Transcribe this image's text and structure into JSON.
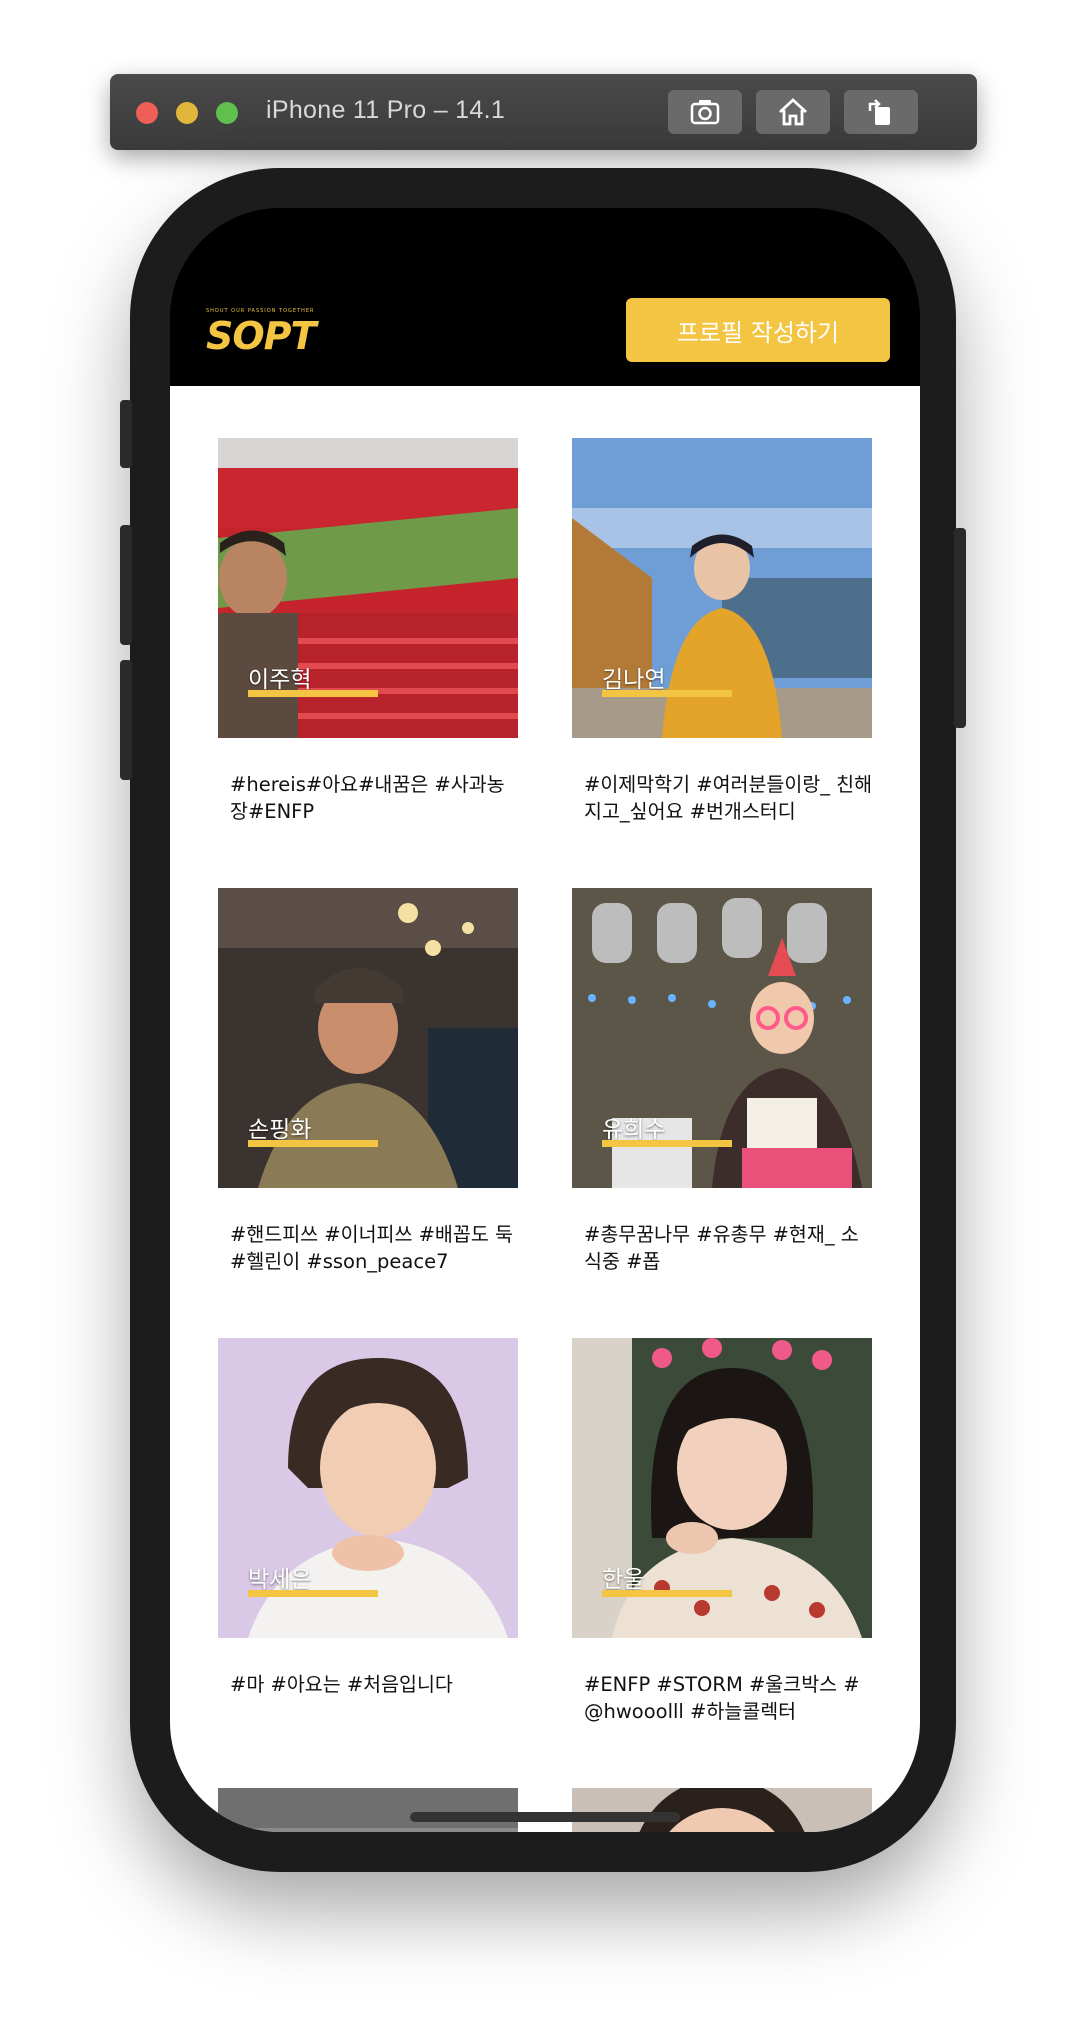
{
  "simulator": {
    "title": "iPhone 11 Pro – 14.1",
    "buttons": [
      "screenshot-icon",
      "home-icon",
      "rotate-icon"
    ]
  },
  "header": {
    "logo_tagline": "SHOUT OUR PASSION TOGETHER",
    "logo_text": "SOPT",
    "profile_button": "프로필 작성하기"
  },
  "colors": {
    "accent": "#f4c542",
    "header_bg": "#000000"
  },
  "cards": [
    {
      "name": "이주혁",
      "tags": "#hereis#아요#내꿈은 #사과농장#ENFP",
      "photo": "stadium"
    },
    {
      "name": "김나연",
      "tags": "#이제막학기 #여러분들이랑_ 친해지고_싶어요 #번개스터디",
      "photo": "river"
    },
    {
      "name": "손핑화",
      "tags": "#핸드피쓰 #이너피쓰 #배꼽도 둑 #헬린이 #sson_peace7",
      "photo": "pub"
    },
    {
      "name": "유희수",
      "tags": "#총무꿈나무 #유총무 #현재_ 소식중 #폽",
      "photo": "birthday"
    },
    {
      "name": "박세은",
      "tags": "#마 #아요는 #처음입니다",
      "photo": "portrait"
    },
    {
      "name": "한울",
      "tags": "#ENFP #STORM #울크박스 #@hwooolll #하늘콜렉터",
      "photo": "sweater"
    }
  ]
}
